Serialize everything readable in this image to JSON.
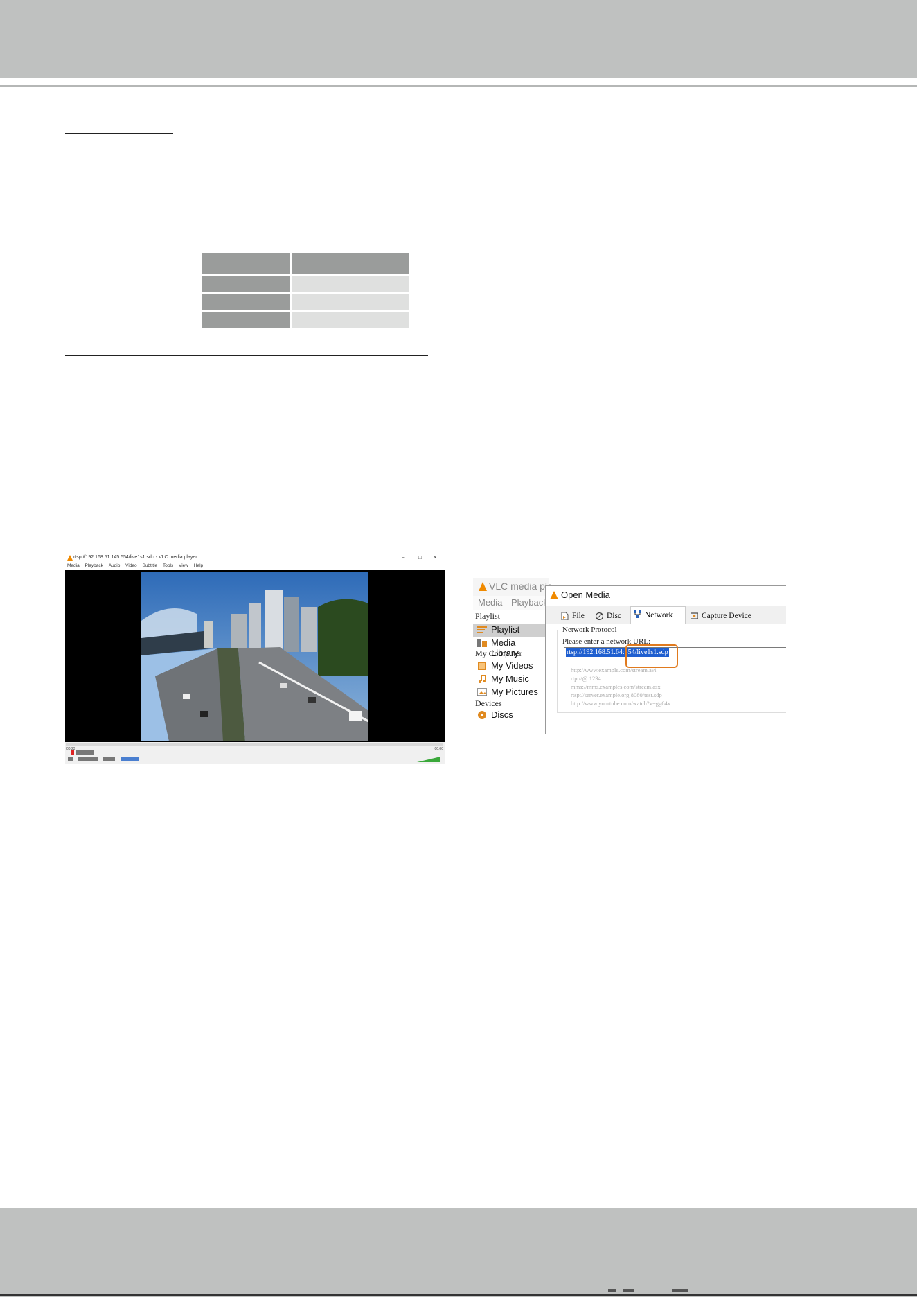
{
  "vlc_player": {
    "window_title": "rtsp://192.168.51.145:554/live1s1.sdp - VLC media player",
    "window_buttons": [
      "–",
      "□",
      "×"
    ],
    "menu": [
      "Media",
      "Playback",
      "Audio",
      "Video",
      "Subtitle",
      "Tools",
      "View",
      "Help"
    ],
    "time_elapsed": "00:23",
    "time_total": "00:00"
  },
  "open_media": {
    "background_app_title": "VLC media pla",
    "background_menu": [
      "Media",
      "Playback"
    ],
    "sidebar": {
      "section_playlist": "Playlist",
      "items_playlist": [
        "Playlist",
        "Media Library"
      ],
      "section_computer": "My Computer",
      "items_computer": [
        "My Videos",
        "My Music",
        "My Pictures"
      ],
      "section_devices": "Devices",
      "items_devices": [
        "Discs"
      ]
    },
    "dialog_title": "Open Media",
    "dialog_minimize": "–",
    "tabs": [
      "File",
      "Disc",
      "Network",
      "Capture Device"
    ],
    "active_tab": "Network",
    "group_title": "Network Protocol",
    "prompt": "Please enter a network URL:",
    "url_value": "rtsp://192.168.51.64:554/live1s1.sdp",
    "examples": [
      "http://www.example.com/stream.avi",
      "rtp://@:1234",
      "mms://mms.examples.com/stream.asx",
      "rtsp://server.example.org:8080/test.sdp",
      "http://www.yourtube.com/watch?v=gg64x"
    ]
  },
  "icons": {
    "vlc_cone": "vlc-cone-icon",
    "highlight_color": "#e07a1e",
    "selection_color": "#1f5fd0"
  }
}
